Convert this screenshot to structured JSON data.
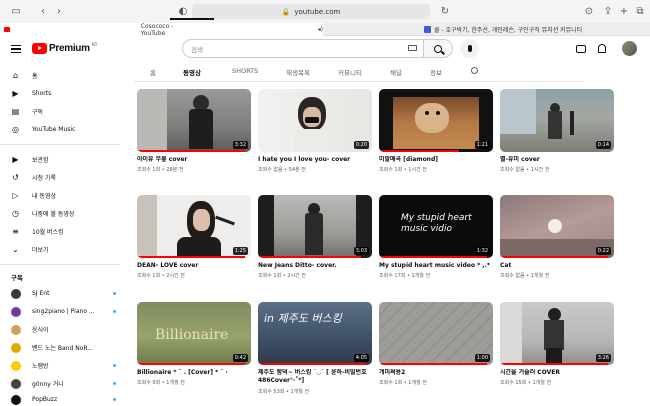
{
  "browser": {
    "url": "youtube.com",
    "tab_active": "Cosococo - YouTube",
    "tab_other": "쿨 - 호구박기, 한주선, 개인레슨, 구인구직 뮤지션 커뮤니티"
  },
  "header": {
    "logo_text": "Premium",
    "logo_country": "KR",
    "search_placeholder": "검색"
  },
  "sidebar": {
    "main_items": [
      {
        "label": "홈",
        "icon": "home-icon"
      },
      {
        "label": "Shorts",
        "icon": "shorts-icon"
      },
      {
        "label": "구독",
        "icon": "subscriptions-icon"
      },
      {
        "label": "YouTube Music",
        "icon": "music-icon"
      }
    ],
    "library_items": [
      {
        "label": "보관함",
        "icon": "library-icon"
      },
      {
        "label": "시청 기록",
        "icon": "history-icon"
      },
      {
        "label": "내 동영상",
        "icon": "my-videos-icon"
      },
      {
        "label": "나중에 볼 동영상",
        "icon": "watch-later-icon"
      },
      {
        "label": "10월 버스킹",
        "icon": "playlist-icon"
      },
      {
        "label": "더보기",
        "icon": "chevron-down-icon"
      }
    ],
    "subscriptions_heading": "구독",
    "subscriptions": [
      {
        "label": "SJ Ent",
        "color": "#3a3a3a"
      },
      {
        "label": "sing2piano | Piano ...",
        "color": "#6b3fa0"
      },
      {
        "label": "응식이",
        "color": "#c9a25a"
      },
      {
        "label": "밴드 노는 Band NoR...",
        "color": "#e0a800"
      },
      {
        "label": "노잼방",
        "color": "#ffcc00"
      },
      {
        "label": "g0nny 거니",
        "color": "#444"
      },
      {
        "label": "PopBuzz",
        "color": "#111"
      }
    ]
  },
  "channel_tabs": [
    "홈",
    "동영상",
    "SHORTS",
    "재생목록",
    "커뮤니티",
    "채널",
    "정보"
  ],
  "active_tab": "동영상",
  "videos": [
    {
      "title": "아이유 무릎 cover",
      "meta": "조회수 1회 • 28분 전",
      "duration": "3:32",
      "progress": 0.95
    },
    {
      "title": "I hate you I love you- cover",
      "meta": "조회수 없음 • 54분 전",
      "duration": "0:20",
      "progress": 0
    },
    {
      "title": "미발매곡 [diamond]",
      "meta": "조회수 1회 • 1시간 전",
      "duration": "1:21",
      "progress": 0.7
    },
    {
      "title": "별-유미 cover",
      "meta": "조회수 없음 • 1시간 전",
      "duration": "0:14",
      "progress": 0
    },
    {
      "title": "DEAN- LOVE cover",
      "meta": "조회수 1회 • 2시간 전",
      "duration": "1:25",
      "progress": 0.95
    },
    {
      "title": "New Jeans Ditto- cover.",
      "meta": "조회수 1회 • 2시간 전",
      "duration": "3:03",
      "progress": 0.9
    },
    {
      "title": "My stupid heart music video * ,.*",
      "meta": "조회수 17회 • 1개월 전",
      "duration": "1:32",
      "progress": 0.95
    },
    {
      "title": "Cat",
      "meta": "조회수 없음 • 1개월 전",
      "duration": "0:22",
      "progress": 0.95
    },
    {
      "title": "Billionaire * ˚ . [Cover] * ˚ ·",
      "meta": "조회수 9회 • 1개월 전",
      "duration": "0:42",
      "progress": 0.95
    },
    {
      "title": "제주도 함덕~ 버스킹 ˙◡˙ [ 윤하-비밀번호 486Cover°·˚*]",
      "meta": "조회수 53회 • 1개월 전",
      "duration": "4:05",
      "progress": 0.95
    },
    {
      "title": "개미써용2",
      "meta": "조회수 1회 • 1개월 전",
      "duration": "1:00",
      "progress": 0.95
    },
    {
      "title": "시간을 거슬러 COVER",
      "meta": "조회수 15회 • 1개월 전",
      "duration": "3:26",
      "progress": 0.95
    }
  ],
  "thumb_texts": {
    "v6": "My stupid heart music vidio",
    "v8": "Billionaire",
    "v9": "in 제주도 버스킹"
  }
}
